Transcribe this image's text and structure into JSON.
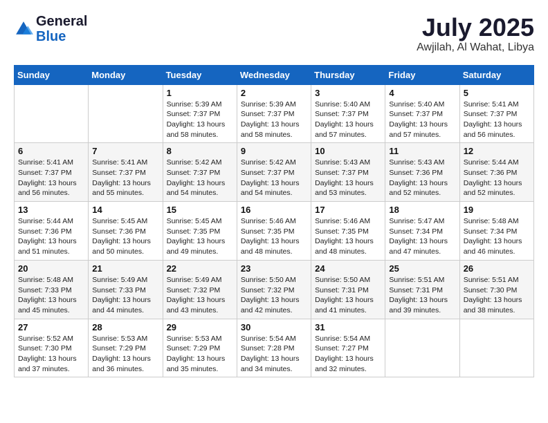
{
  "logo": {
    "general": "General",
    "blue": "Blue"
  },
  "header": {
    "month": "July 2025",
    "location": "Awjilah, Al Wahat, Libya"
  },
  "weekdays": [
    "Sunday",
    "Monday",
    "Tuesday",
    "Wednesday",
    "Thursday",
    "Friday",
    "Saturday"
  ],
  "weeks": [
    [
      {
        "day": "",
        "detail": ""
      },
      {
        "day": "",
        "detail": ""
      },
      {
        "day": "1",
        "detail": "Sunrise: 5:39 AM\nSunset: 7:37 PM\nDaylight: 13 hours and 58 minutes."
      },
      {
        "day": "2",
        "detail": "Sunrise: 5:39 AM\nSunset: 7:37 PM\nDaylight: 13 hours and 58 minutes."
      },
      {
        "day": "3",
        "detail": "Sunrise: 5:40 AM\nSunset: 7:37 PM\nDaylight: 13 hours and 57 minutes."
      },
      {
        "day": "4",
        "detail": "Sunrise: 5:40 AM\nSunset: 7:37 PM\nDaylight: 13 hours and 57 minutes."
      },
      {
        "day": "5",
        "detail": "Sunrise: 5:41 AM\nSunset: 7:37 PM\nDaylight: 13 hours and 56 minutes."
      }
    ],
    [
      {
        "day": "6",
        "detail": "Sunrise: 5:41 AM\nSunset: 7:37 PM\nDaylight: 13 hours and 56 minutes."
      },
      {
        "day": "7",
        "detail": "Sunrise: 5:41 AM\nSunset: 7:37 PM\nDaylight: 13 hours and 55 minutes."
      },
      {
        "day": "8",
        "detail": "Sunrise: 5:42 AM\nSunset: 7:37 PM\nDaylight: 13 hours and 54 minutes."
      },
      {
        "day": "9",
        "detail": "Sunrise: 5:42 AM\nSunset: 7:37 PM\nDaylight: 13 hours and 54 minutes."
      },
      {
        "day": "10",
        "detail": "Sunrise: 5:43 AM\nSunset: 7:37 PM\nDaylight: 13 hours and 53 minutes."
      },
      {
        "day": "11",
        "detail": "Sunrise: 5:43 AM\nSunset: 7:36 PM\nDaylight: 13 hours and 52 minutes."
      },
      {
        "day": "12",
        "detail": "Sunrise: 5:44 AM\nSunset: 7:36 PM\nDaylight: 13 hours and 52 minutes."
      }
    ],
    [
      {
        "day": "13",
        "detail": "Sunrise: 5:44 AM\nSunset: 7:36 PM\nDaylight: 13 hours and 51 minutes."
      },
      {
        "day": "14",
        "detail": "Sunrise: 5:45 AM\nSunset: 7:36 PM\nDaylight: 13 hours and 50 minutes."
      },
      {
        "day": "15",
        "detail": "Sunrise: 5:45 AM\nSunset: 7:35 PM\nDaylight: 13 hours and 49 minutes."
      },
      {
        "day": "16",
        "detail": "Sunrise: 5:46 AM\nSunset: 7:35 PM\nDaylight: 13 hours and 48 minutes."
      },
      {
        "day": "17",
        "detail": "Sunrise: 5:46 AM\nSunset: 7:35 PM\nDaylight: 13 hours and 48 minutes."
      },
      {
        "day": "18",
        "detail": "Sunrise: 5:47 AM\nSunset: 7:34 PM\nDaylight: 13 hours and 47 minutes."
      },
      {
        "day": "19",
        "detail": "Sunrise: 5:48 AM\nSunset: 7:34 PM\nDaylight: 13 hours and 46 minutes."
      }
    ],
    [
      {
        "day": "20",
        "detail": "Sunrise: 5:48 AM\nSunset: 7:33 PM\nDaylight: 13 hours and 45 minutes."
      },
      {
        "day": "21",
        "detail": "Sunrise: 5:49 AM\nSunset: 7:33 PM\nDaylight: 13 hours and 44 minutes."
      },
      {
        "day": "22",
        "detail": "Sunrise: 5:49 AM\nSunset: 7:32 PM\nDaylight: 13 hours and 43 minutes."
      },
      {
        "day": "23",
        "detail": "Sunrise: 5:50 AM\nSunset: 7:32 PM\nDaylight: 13 hours and 42 minutes."
      },
      {
        "day": "24",
        "detail": "Sunrise: 5:50 AM\nSunset: 7:31 PM\nDaylight: 13 hours and 41 minutes."
      },
      {
        "day": "25",
        "detail": "Sunrise: 5:51 AM\nSunset: 7:31 PM\nDaylight: 13 hours and 39 minutes."
      },
      {
        "day": "26",
        "detail": "Sunrise: 5:51 AM\nSunset: 7:30 PM\nDaylight: 13 hours and 38 minutes."
      }
    ],
    [
      {
        "day": "27",
        "detail": "Sunrise: 5:52 AM\nSunset: 7:30 PM\nDaylight: 13 hours and 37 minutes."
      },
      {
        "day": "28",
        "detail": "Sunrise: 5:53 AM\nSunset: 7:29 PM\nDaylight: 13 hours and 36 minutes."
      },
      {
        "day": "29",
        "detail": "Sunrise: 5:53 AM\nSunset: 7:29 PM\nDaylight: 13 hours and 35 minutes."
      },
      {
        "day": "30",
        "detail": "Sunrise: 5:54 AM\nSunset: 7:28 PM\nDaylight: 13 hours and 34 minutes."
      },
      {
        "day": "31",
        "detail": "Sunrise: 5:54 AM\nSunset: 7:27 PM\nDaylight: 13 hours and 32 minutes."
      },
      {
        "day": "",
        "detail": ""
      },
      {
        "day": "",
        "detail": ""
      }
    ]
  ]
}
